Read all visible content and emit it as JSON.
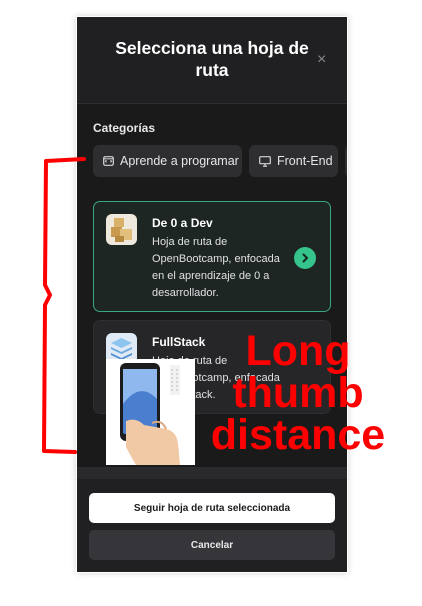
{
  "modal": {
    "title": "Selecciona una hoja de ruta",
    "close_icon": "×"
  },
  "categories": {
    "label": "Categorías",
    "chips": [
      {
        "label": "Aprende a programar",
        "icon": "code-window-icon"
      },
      {
        "label": "Front-End",
        "icon": "monitor-icon"
      }
    ]
  },
  "roadmaps": [
    {
      "title": "De 0 a Dev",
      "description": "Hoja de ruta de OpenBootcamp, enfocada en el aprendizaje de 0 a desarrollador.",
      "selected": true,
      "icon": "boxes-icon"
    },
    {
      "title": "FullStack",
      "description": "Hoja de ruta de OpenBootcamp, enfocada en FullStack.",
      "selected": false,
      "icon": "layers-icon"
    }
  ],
  "footer": {
    "primary_label": "Seguir hoja de ruta seleccionada",
    "secondary_label": "Cancelar"
  },
  "overlay": {
    "annotation": "Long thumb distance",
    "annotation_color": "#ff0000"
  },
  "colors": {
    "accent": "#35c48c",
    "selected_border": "#3aa87f",
    "background": "#1a1a1b"
  }
}
